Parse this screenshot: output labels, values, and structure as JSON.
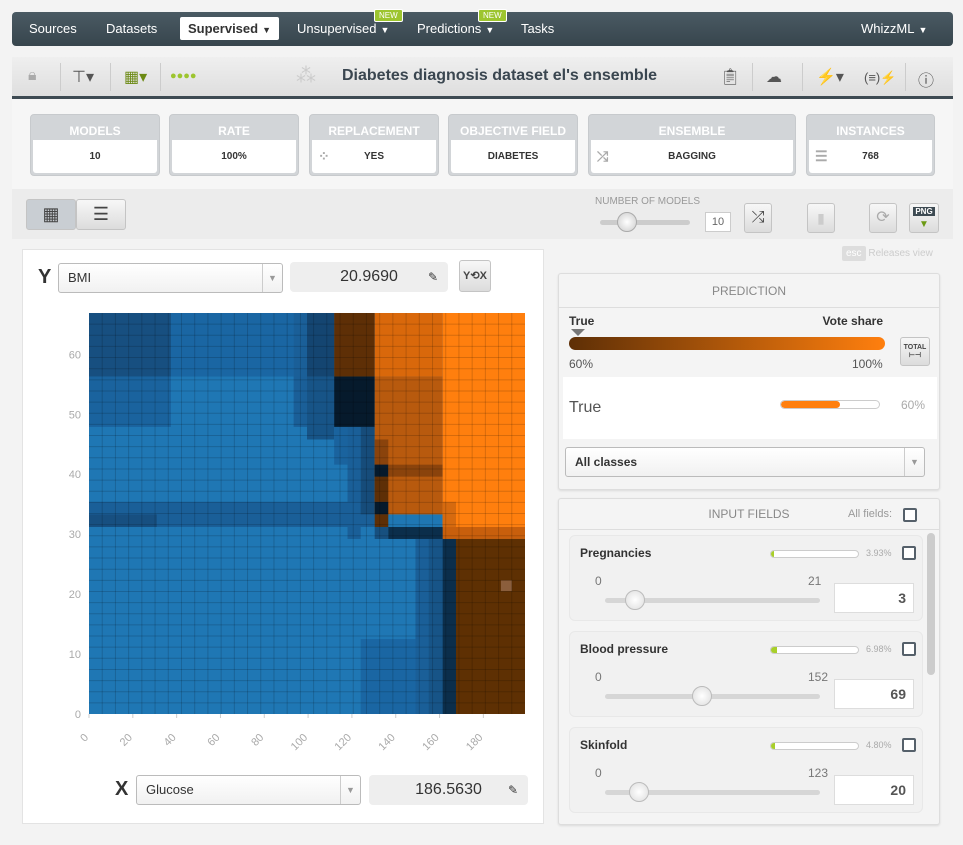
{
  "nav": {
    "items": [
      "Sources",
      "Datasets",
      "Supervised",
      "Unsupervised",
      "Predictions",
      "Tasks"
    ],
    "badges": {
      "unsupervised": "NEW",
      "predictions": "NEW"
    },
    "right": "WhizzML"
  },
  "toolbar": {
    "title": "Diabetes diagnosis dataset el's ensemble"
  },
  "summary": [
    {
      "label": "MODELS",
      "value": "10"
    },
    {
      "label": "RATE",
      "value": "100%"
    },
    {
      "label": "REPLACEMENT",
      "value": "YES"
    },
    {
      "label": "OBJECTIVE FIELD",
      "value": "DIABETES"
    },
    {
      "label": "ENSEMBLE",
      "value": "BAGGING"
    },
    {
      "label": "INSTANCES",
      "value": "768"
    }
  ],
  "controls": {
    "number_of_models_label": "NUMBER OF MODELS",
    "number_of_models": "10",
    "png_label": "PNG"
  },
  "releases": {
    "esc": "esc",
    "label": "Releases view"
  },
  "axes": {
    "y_label": "Y",
    "y_field": "BMI",
    "y_value": "20.9690",
    "x_label": "X",
    "x_field": "Glucose",
    "x_value": "186.5630"
  },
  "prediction": {
    "header": "PREDICTION",
    "class": "True",
    "legend_right": "Vote share",
    "min": "60%",
    "max": "100%",
    "total_label": "TOTAL",
    "result_class": "True",
    "result_pct": "60%",
    "result_share": 0.6,
    "filter": "All classes",
    "colors": {
      "low": "#5e2f06",
      "high": "#ff7f0e"
    }
  },
  "inputs": {
    "header": "INPUT FIELDS",
    "all_fields": "All fields:",
    "fields": [
      {
        "name": "Pregnancies",
        "importance": "3.93%",
        "imp": 0.0393,
        "min": "0",
        "max": "21",
        "value": "3"
      },
      {
        "name": "Blood pressure",
        "importance": "6.98%",
        "imp": 0.0698,
        "min": "0",
        "max": "152",
        "value": "69"
      },
      {
        "name": "Skinfold",
        "importance": "4.80%",
        "imp": 0.048,
        "min": "0",
        "max": "123",
        "value": "20"
      }
    ]
  },
  "chart_data": {
    "type": "heatmap",
    "xlabel": "Glucose",
    "ylabel": "BMI",
    "xlim": [
      0,
      199
    ],
    "ylim": [
      0,
      66.9
    ],
    "xticks": [
      0,
      20,
      40,
      60,
      80,
      100,
      120,
      140,
      160,
      180
    ],
    "yticks": [
      0,
      10,
      20,
      30,
      40,
      50,
      60
    ],
    "grid": "on",
    "classes": {
      "False": "#1f77b4",
      "True": "#ff7f0e"
    },
    "regions": [
      {
        "x": [
          0,
          199
        ],
        "y": [
          0,
          66.9
        ],
        "color": "#1f77b4"
      },
      {
        "x": [
          0,
          37.4
        ],
        "y": [
          56.3,
          66.9
        ],
        "color": "#174f80"
      },
      {
        "x": [
          0,
          37.4
        ],
        "y": [
          47.9,
          56.3
        ],
        "color": "#1a639e"
      },
      {
        "x": [
          37.4,
          93.4
        ],
        "y": [
          56.3,
          66.9
        ],
        "color": "#1a66a3"
      },
      {
        "x": [
          93.4,
          99.5
        ],
        "y": [
          47.9,
          66.9
        ],
        "color": "#1a5f98"
      },
      {
        "x": [
          99.5,
          111.9
        ],
        "y": [
          56.3,
          66.9
        ],
        "color": "#144571"
      },
      {
        "x": [
          99.5,
          111.9
        ],
        "y": [
          45.8,
          56.3
        ],
        "color": "#175487"
      },
      {
        "x": [
          0,
          130.4
        ],
        "y": [
          31.2,
          35.4
        ],
        "color": "#1a5f98"
      },
      {
        "x": [
          0,
          31
        ],
        "y": [
          31.2,
          33.3
        ],
        "color": "#174f80"
      },
      {
        "x": [
          111.9,
          118
        ],
        "y": [
          41.6,
          47.9
        ],
        "color": "#1a639e"
      },
      {
        "x": [
          118,
          124
        ],
        "y": [
          29.2,
          47.9
        ],
        "color": "#1a5f98"
      },
      {
        "x": [
          124,
          130.4
        ],
        "y": [
          33.3,
          47.9
        ],
        "color": "#164c7a"
      },
      {
        "x": [
          111.9,
          130.4
        ],
        "y": [
          56.3,
          66.9
        ],
        "color": "#5e2f06"
      },
      {
        "x": [
          111.9,
          130.4
        ],
        "y": [
          47.9,
          56.3
        ],
        "color": "#061a2c"
      },
      {
        "x": [
          130.4,
          161.4
        ],
        "y": [
          56.3,
          66.9
        ],
        "color": "#d9680b"
      },
      {
        "x": [
          130.4,
          161.4
        ],
        "y": [
          33.3,
          56.3
        ],
        "color": "#b85a0e"
      },
      {
        "x": [
          130.4,
          136.6
        ],
        "y": [
          41.6,
          45.8
        ],
        "color": "#8a430c"
      },
      {
        "x": [
          130.4,
          136.6
        ],
        "y": [
          35.4,
          41.6
        ],
        "color": "#5e2f06"
      },
      {
        "x": [
          130.4,
          136.6
        ],
        "y": [
          39.6,
          41.6
        ],
        "color": "#061a2c"
      },
      {
        "x": [
          136.6,
          161.4
        ],
        "y": [
          39.6,
          41.6
        ],
        "color": "#8a430c"
      },
      {
        "x": [
          130.4,
          136.6
        ],
        "y": [
          33.3,
          35.4
        ],
        "color": "#061a2c"
      },
      {
        "x": [
          130.4,
          136.6
        ],
        "y": [
          31.2,
          33.3
        ],
        "color": "#5e2f06"
      },
      {
        "x": [
          161.4,
          199
        ],
        "y": [
          31.2,
          66.9
        ],
        "color": "#ff7f0e"
      },
      {
        "x": [
          161.4,
          167.5
        ],
        "y": [
          31.2,
          35.4
        ],
        "color": "#d66a0f"
      },
      {
        "x": [
          161.4,
          199
        ],
        "y": [
          29.2,
          31.2
        ],
        "color": "#c85f0c"
      },
      {
        "x": [
          130.4,
          136.6
        ],
        "y": [
          29.2,
          31.2
        ],
        "color": "#17507f"
      },
      {
        "x": [
          136.6,
          161.4
        ],
        "y": [
          29.2,
          31.2
        ],
        "color": "#0b2e4b"
      },
      {
        "x": [
          149,
          155
        ],
        "y": [
          0,
          29.2
        ],
        "color": "#1a5f98"
      },
      {
        "x": [
          155,
          161.4
        ],
        "y": [
          0,
          29.2
        ],
        "color": "#175487"
      },
      {
        "x": [
          124,
          149
        ],
        "y": [
          0,
          12.5
        ],
        "color": "#1a66a3"
      },
      {
        "x": [
          161.4,
          167.5
        ],
        "y": [
          0,
          29.2
        ],
        "color": "#0b2e4b"
      },
      {
        "x": [
          167.5,
          199
        ],
        "y": [
          0,
          29.2
        ],
        "color": "#5e3003"
      },
      {
        "x": [
          188,
          193
        ],
        "y": [
          20.5,
          22.3
        ],
        "color": "#8b5e3c"
      }
    ]
  }
}
